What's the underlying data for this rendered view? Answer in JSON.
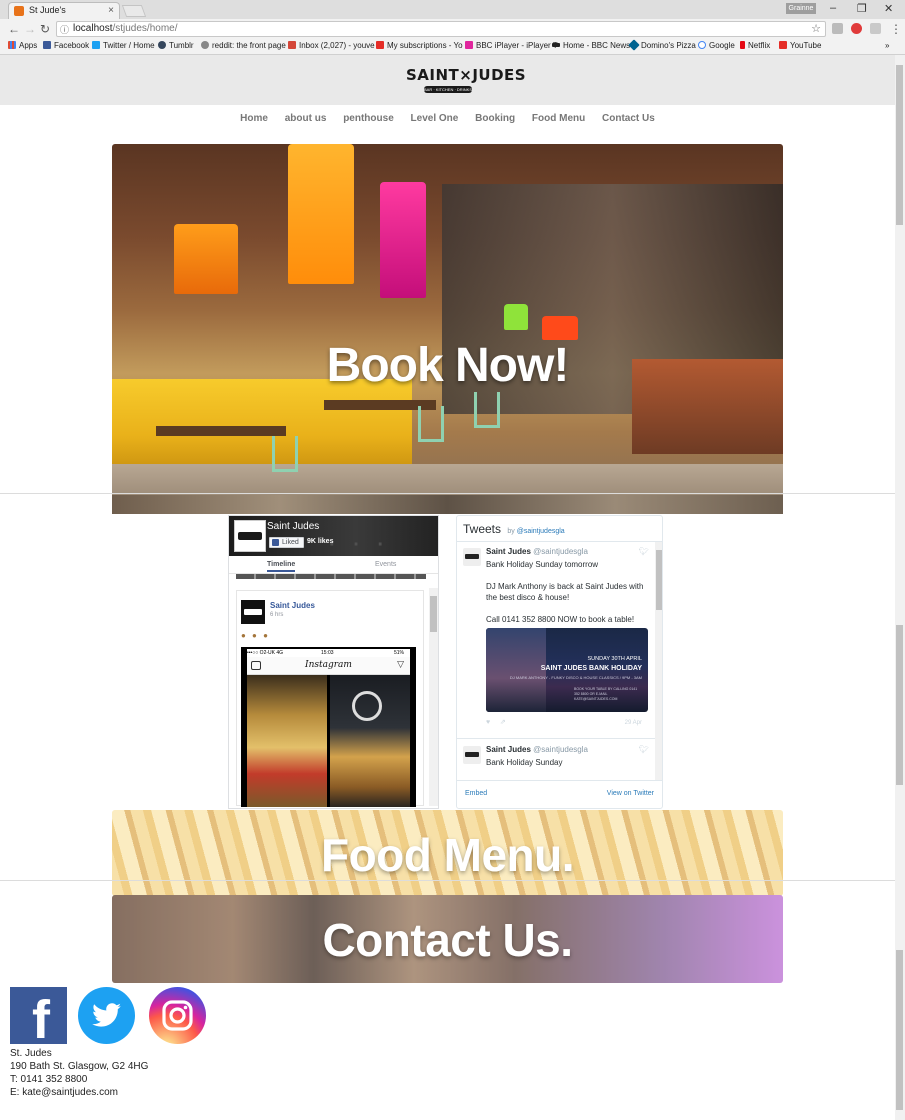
{
  "browser": {
    "tab_title": "St Jude's",
    "profile_label": "Grainne",
    "url_host": "localhost",
    "url_path": "/stjudes/home/",
    "bookmarks": [
      "Apps",
      "Facebook",
      "Twitter / Home",
      "Tumblr",
      "reddit: the front page",
      "Inbox (2,027) - youve",
      "My subscriptions - Yo",
      "BBC iPlayer - iPlayer T",
      "Home - BBC News",
      "Domino's Pizza",
      "Google",
      "Netflix",
      "YouTube"
    ],
    "overflow": "»"
  },
  "site": {
    "logo_text": "SAINT×JUDES",
    "logo_sub": "BAR · KITCHEN · DRINKS",
    "nav": [
      "Home",
      "about us",
      "penthouse",
      "Level One",
      "Booking",
      "Food Menu",
      "Contact Us"
    ],
    "hero_title": "Book Now!",
    "food_banner": "Food Menu.",
    "contact_banner": "Contact Us."
  },
  "facebook": {
    "page_name": "Saint Judes",
    "liked_label": "Liked",
    "likes": "9K likes",
    "tabs": [
      "Timeline",
      "Events"
    ],
    "post_author": "Saint Judes",
    "post_time": "6 hrs",
    "phone_carrier": "•••○○ O2-UK  4G",
    "phone_time": "15:03",
    "phone_battery": "51%",
    "instagram_title": "Instagram"
  },
  "twitter": {
    "title": "Tweets",
    "by": "by",
    "handle_link": "@saintjudesgla",
    "tweets": [
      {
        "name": "Saint Judes",
        "handle": "@saintjudesgla",
        "text": "Bank Holiday Sunday tomorrow\n\nDJ Mark Anthony is back at Saint Judes with the best disco & house!\n\nCall 0141 352 8800 NOW to book a table!",
        "card_date": "SUNDAY 30TH APRIL",
        "card_title": "SAINT JUDES BANK HOLIDAY",
        "card_sub": "DJ MARK ANTHONY - FUNKY DISCO & HOUSE CLASSICS / 9PM - 3AM",
        "card_fine": "BOOK YOUR TABLE BY CALLING 0141 352 8800 OR E-MAIL KATE@SAINTJUDES.COM",
        "date": "29 Apr"
      },
      {
        "name": "Saint Judes",
        "handle": "@saintjudesgla",
        "text": "Bank Holiday Sunday"
      }
    ],
    "embed": "Embed",
    "view": "View on Twitter"
  },
  "contact": {
    "name": "St. Judes",
    "address": "190 Bath St. Glasgow, G2 4HG",
    "phone": "T: 0141 352 8800",
    "email": "E: kate@saintjudes.com"
  },
  "colors": {
    "facebook": "#3b5998",
    "twitter": "#1da1f2",
    "header_bg": "#e9e9e9",
    "nav_text": "#777777"
  }
}
